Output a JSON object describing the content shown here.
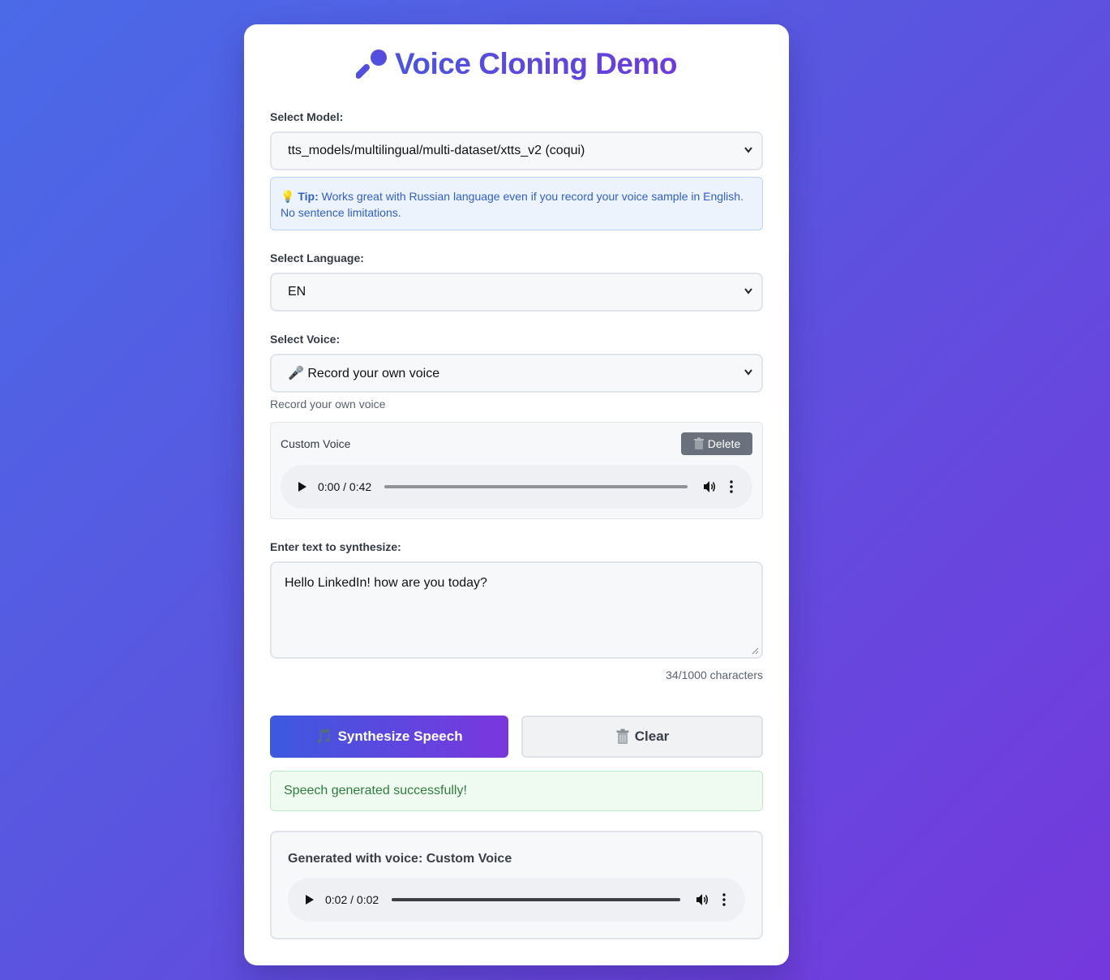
{
  "app": {
    "title": "Voice Cloning Demo",
    "title_icon": "microphone-icon"
  },
  "model": {
    "label": "Select Model:",
    "selected": "tts_models/multilingual/multi-dataset/xtts_v2 (coqui)"
  },
  "tip": {
    "icon": "lightbulb-icon",
    "prefix": "Tip:",
    "text": "Works great with Russian language even if you record your voice sample in English. No sentence limitations."
  },
  "language": {
    "label": "Select Language:",
    "selected": "EN"
  },
  "voice": {
    "label": "Select Voice:",
    "selected": "🎤 Record your own voice",
    "hint": "Record your own voice"
  },
  "custom_voice": {
    "label": "Custom Voice",
    "delete_label": "Delete",
    "delete_icon": "trash-icon",
    "audio": {
      "time": "0:00 / 0:42",
      "progress": 0.0
    }
  },
  "text_input": {
    "label": "Enter text to synthesize:",
    "value": "Hello LinkedIn! how are you today?",
    "counter": "34/1000 characters"
  },
  "actions": {
    "synthesize_label": "Synthesize Speech",
    "synthesize_icon": "music-note-icon",
    "clear_label": "Clear",
    "clear_icon": "trash-icon"
  },
  "status": {
    "message": "Speech generated successfully!"
  },
  "result": {
    "title": "Generated with voice: Custom Voice",
    "audio": {
      "time": "0:02 / 0:02",
      "progress": 1.0
    }
  },
  "colors": {
    "accent": "#5545d6",
    "gradient_start": "#4a6ae8",
    "gradient_end": "#7538dc",
    "success": "#2f7d3c"
  }
}
